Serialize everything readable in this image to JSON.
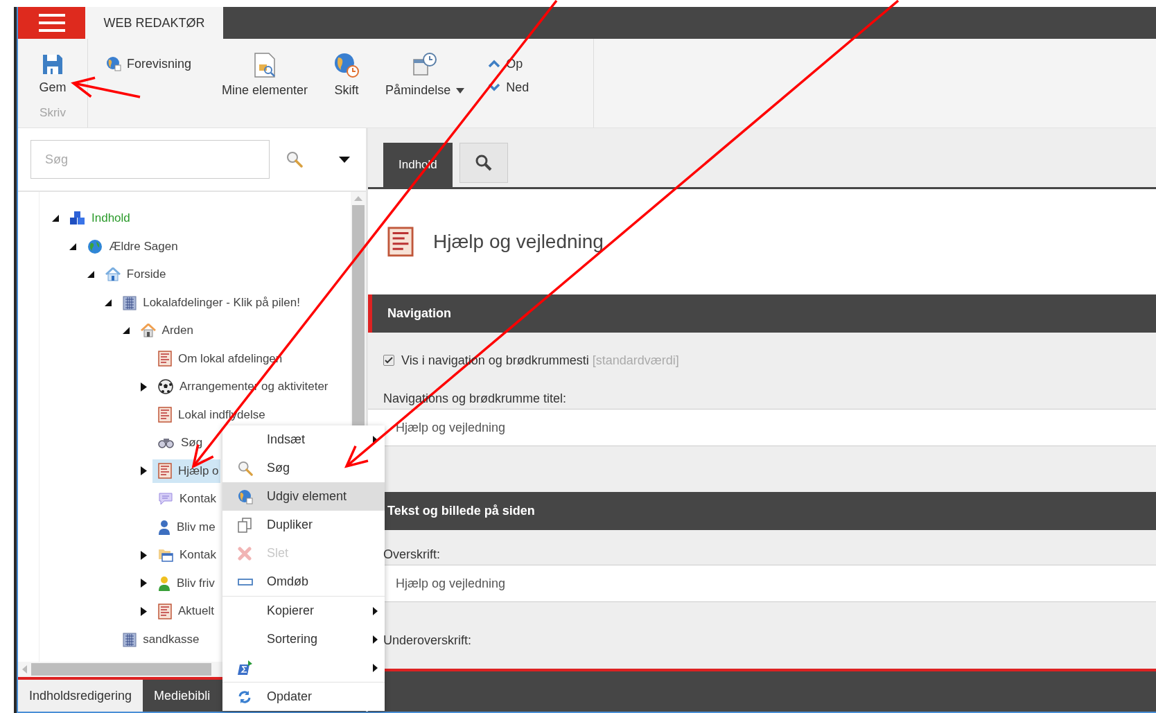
{
  "app_bar": {
    "title": "WEB REDAKTØR"
  },
  "ribbon": {
    "save": {
      "label": "Gem",
      "group": "Skriv"
    },
    "buttons": [
      {
        "kind": "small",
        "label": "Forevisning"
      },
      {
        "kind": "large",
        "label": "Mine elementer"
      },
      {
        "kind": "large",
        "label": "Skift"
      },
      {
        "kind": "dropdown",
        "label": "Påmindelse"
      }
    ],
    "move": [
      {
        "kind": "up",
        "label": "Op"
      },
      {
        "kind": "down",
        "label": "Ned"
      }
    ]
  },
  "search": {
    "placeholder": "Søg"
  },
  "tree": [
    {
      "label": "Indhold",
      "kind": "root",
      "expanded": true,
      "selected": false,
      "children": [
        {
          "label": "Ældre Sagen",
          "kind": "site",
          "expanded": true,
          "selected": false,
          "children": [
            {
              "label": "Forside",
              "kind": "frontpage",
              "expanded": true,
              "selected": false,
              "children": [
                {
                  "label": "Lokalafdelinger - Klik på pilen!",
                  "kind": "section",
                  "expanded": true,
                  "selected": false,
                  "children": [
                    {
                      "label": "Arden",
                      "kind": "branch",
                      "expanded": true,
                      "selected": false,
                      "children": [
                        {
                          "label": "Om lokal afdelingen",
                          "kind": "page",
                          "selected": false
                        },
                        {
                          "label": "Arrangementer og aktiviteter",
                          "kind": "event",
                          "expanded": false,
                          "selected": false,
                          "has_children": true
                        },
                        {
                          "label": "Lokal indflydelse",
                          "kind": "page",
                          "selected": false
                        },
                        {
                          "label": "Søg",
                          "kind": "search",
                          "selected": false
                        },
                        {
                          "label": "Hjælp o",
                          "kind": "page",
                          "expanded": false,
                          "selected": true,
                          "has_children": true
                        },
                        {
                          "label": "Kontak",
                          "kind": "contact",
                          "selected": false
                        },
                        {
                          "label": "Bliv me",
                          "kind": "member",
                          "selected": false
                        },
                        {
                          "label": "Kontak",
                          "kind": "folder",
                          "expanded": false,
                          "selected": false,
                          "has_children": true
                        },
                        {
                          "label": "Bliv friv",
                          "kind": "volunteer",
                          "expanded": false,
                          "selected": false,
                          "has_children": true
                        },
                        {
                          "label": "Aktuelt",
                          "kind": "page",
                          "expanded": false,
                          "selected": false,
                          "has_children": true
                        }
                      ]
                    }
                  ]
                },
                {
                  "label": "sandkasse",
                  "kind": "section",
                  "selected": false
                }
              ]
            }
          ]
        }
      ]
    }
  ],
  "bottom_tabs": [
    {
      "label": "Indholdsredigering",
      "selected": true
    },
    {
      "label": "Mediebibli",
      "selected": false
    }
  ],
  "editor": {
    "tabs": [
      {
        "kind": "text",
        "label": "Indhold",
        "selected": true
      },
      {
        "kind": "search",
        "selected": false
      }
    ],
    "title": "Hjælp og vejledning",
    "sections": [
      {
        "title": "Navigation",
        "fields": [
          {
            "kind": "checkbox",
            "label": "Vis i navigation og brødkrummesti",
            "note": "[standardværdi]",
            "checked": true
          },
          {
            "kind": "text",
            "label": "Navigations og brødkrumme titel:",
            "value": "Hjælp og vejledning"
          }
        ]
      },
      {
        "title": "Tekst og billede på siden",
        "fields": [
          {
            "kind": "text",
            "label": "Overskrift:",
            "value": "Hjælp og vejledning"
          },
          {
            "kind": "label",
            "label": "Underoverskrift:"
          }
        ]
      }
    ]
  },
  "context_menu": {
    "groups": [
      [
        {
          "label": "Indsæt",
          "submenu": true,
          "selected": false,
          "disabled": false
        },
        {
          "label": "Søg",
          "submenu": false,
          "selected": false,
          "disabled": false
        },
        {
          "label": "Udgiv element",
          "submenu": false,
          "selected": true,
          "disabled": false
        },
        {
          "label": "Dupliker",
          "submenu": false,
          "selected": false,
          "disabled": false
        },
        {
          "label": "Slet",
          "submenu": false,
          "selected": false,
          "disabled": true
        },
        {
          "label": "Omdøb",
          "submenu": false,
          "selected": false,
          "disabled": false
        }
      ],
      [
        {
          "label": "Kopierer",
          "submenu": true,
          "selected": false,
          "disabled": false
        },
        {
          "label": "Sortering",
          "submenu": true,
          "selected": false,
          "disabled": false
        },
        {
          "submenu": true,
          "selected": false,
          "disabled": false
        }
      ],
      [
        {
          "label": "Opdater",
          "submenu": false,
          "selected": false,
          "disabled": false
        }
      ]
    ]
  },
  "annotations": [
    {
      "kind": "arrow"
    },
    {
      "kind": "arrow"
    },
    {
      "kind": "arrow"
    }
  ]
}
